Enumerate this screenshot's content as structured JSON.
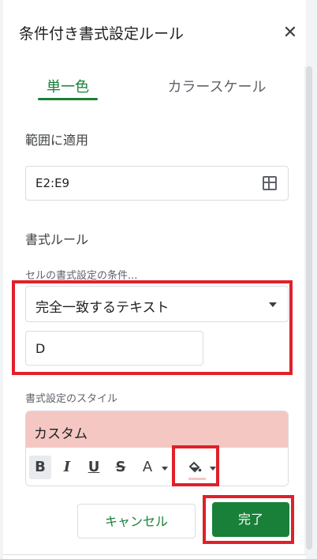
{
  "panel": {
    "title": "条件付き書式設定ルール",
    "close_icon": "close-icon"
  },
  "tabs": [
    {
      "label": "単一色",
      "active": true
    },
    {
      "label": "カラースケール",
      "active": false
    }
  ],
  "range": {
    "label": "範囲に適用",
    "value": "E2:E9",
    "icon": "grid-icon"
  },
  "rules": {
    "section_label": "書式ルール",
    "condition_label": "セルの書式設定の条件...",
    "condition_value": "完全一致するテキスト",
    "input_value": "D"
  },
  "style": {
    "label": "書式設定のスタイル",
    "preview_label": "カスタム",
    "preview_color": "#f4c7c3",
    "toolbar": {
      "bold": "B",
      "italic": "I",
      "underline": "U",
      "strikethrough": "S",
      "text_color": "A",
      "fill_icon": "paint-bucket-icon"
    }
  },
  "buttons": {
    "cancel": "キャンセル",
    "done": "完了"
  },
  "colors": {
    "accent": "#188038",
    "highlight": "#e0202a"
  }
}
